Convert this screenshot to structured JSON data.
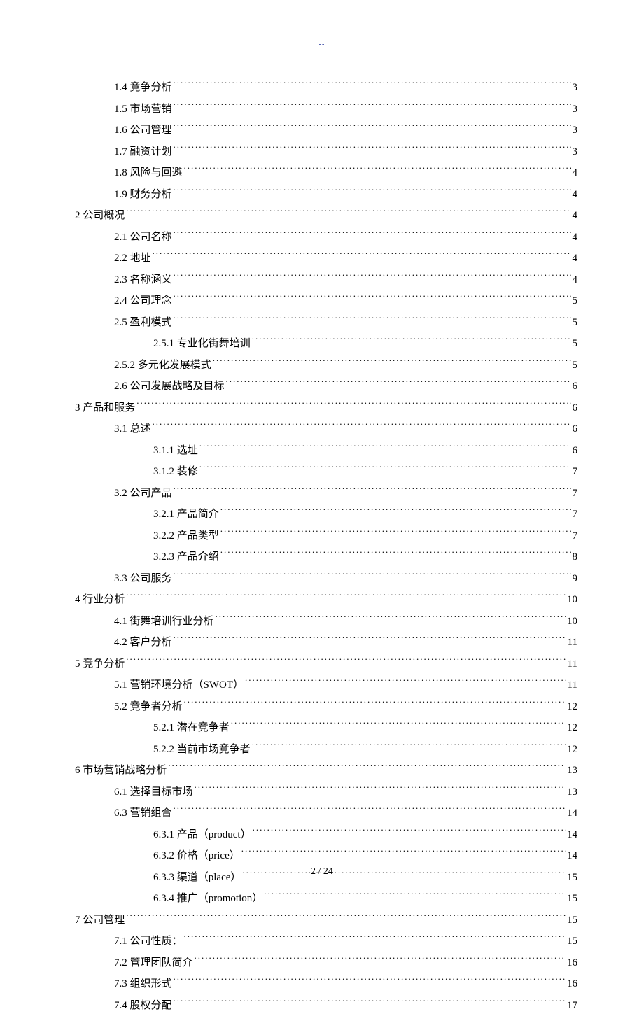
{
  "header_mark": "--",
  "page_number": "2 / 24",
  "toc": [
    {
      "level": 2,
      "label": "1.4 竞争分析",
      "page": "3"
    },
    {
      "level": 2,
      "label": "1.5  市场营销",
      "page": "3"
    },
    {
      "level": 2,
      "label": "1.6  公司管理",
      "page": "3"
    },
    {
      "level": 2,
      "label": "1.7  融资计划",
      "page": "3"
    },
    {
      "level": 2,
      "label": "1.8  风险与回避",
      "page": "4"
    },
    {
      "level": 2,
      "label": "1.9  财务分析",
      "page": "4"
    },
    {
      "level": 1,
      "label": "2 公司概况",
      "page": "4"
    },
    {
      "level": 2,
      "label": "2.1 公司名称",
      "page": "4"
    },
    {
      "level": 2,
      "label": "2.2 地址",
      "page": "4"
    },
    {
      "level": 2,
      "label": "2.3 名称涵义",
      "page": "4"
    },
    {
      "level": 2,
      "label": "2.4 公司理念",
      "page": "5"
    },
    {
      "level": 2,
      "label": "2.5  盈利模式",
      "page": "5"
    },
    {
      "level": 3,
      "label": "2.5.1  专业化街舞培训",
      "page": "5"
    },
    {
      "level": 2,
      "label": "2.5.2  多元化发展模式",
      "page": "5"
    },
    {
      "level": 2,
      "label": "2.6 公司发展战略及目标",
      "page": "6"
    },
    {
      "level": 1,
      "label": "3  产品和服务",
      "page": "6"
    },
    {
      "level": 2,
      "label": "3.1  总述",
      "page": "6"
    },
    {
      "level": 3,
      "label": "3.1.1  选址",
      "page": "6"
    },
    {
      "level": 3,
      "label": "3.1.2  装修",
      "page": "7"
    },
    {
      "level": 2,
      "label": "3.2  公司产品",
      "page": "7"
    },
    {
      "level": 3,
      "label": "3.2.1 产品简介",
      "page": "7"
    },
    {
      "level": 3,
      "label": "3.2.2    产品类型",
      "page": "7"
    },
    {
      "level": 3,
      "label": "3.2.3  产品介绍",
      "page": "8"
    },
    {
      "level": 2,
      "label": "3.3  公司服务",
      "page": "9"
    },
    {
      "level": 1,
      "label": "4  行业分析",
      "page": "10"
    },
    {
      "level": 2,
      "label": "4.1 街舞培训行业分析",
      "page": "10"
    },
    {
      "level": 2,
      "label": "4.2 客户分析",
      "page": "11"
    },
    {
      "level": 1,
      "label": "5 竞争分析",
      "page": "11"
    },
    {
      "level": 2,
      "label": "5.1 营销环境分析（SWOT）",
      "page": "11"
    },
    {
      "level": 2,
      "label": "5.2  竞争者分析",
      "page": "12"
    },
    {
      "level": 3,
      "label": "5.2.1 潜在竞争者",
      "page": "12"
    },
    {
      "level": 3,
      "label": "5.2.2 当前市场竞争者",
      "page": "12"
    },
    {
      "level": 1,
      "label": "6  市场营销战略分析",
      "page": "13"
    },
    {
      "level": 2,
      "label": "6.1  选择目标市场",
      "page": "13"
    },
    {
      "level": 2,
      "label": "6.3  营销组合",
      "page": "14"
    },
    {
      "level": 3,
      "label": "6.3.1 产品（product）",
      "page": "14"
    },
    {
      "level": 3,
      "label": "6.3.2 价格（price）",
      "page": "14"
    },
    {
      "level": 3,
      "label": "6.3.3 渠道（place）",
      "page": "15"
    },
    {
      "level": 3,
      "label": "6.3.4 推广（promotion）",
      "page": "15"
    },
    {
      "level": 1,
      "label": "7 公司管理",
      "page": "15"
    },
    {
      "level": 2,
      "label": "7.1 公司性质：",
      "page": "15"
    },
    {
      "level": 2,
      "label": "7.2 管理团队简介",
      "page": "16"
    },
    {
      "level": 2,
      "label": "7.3 组织形式",
      "page": "16"
    },
    {
      "level": 2,
      "label": "7.4 股权分配",
      "page": "17"
    }
  ]
}
